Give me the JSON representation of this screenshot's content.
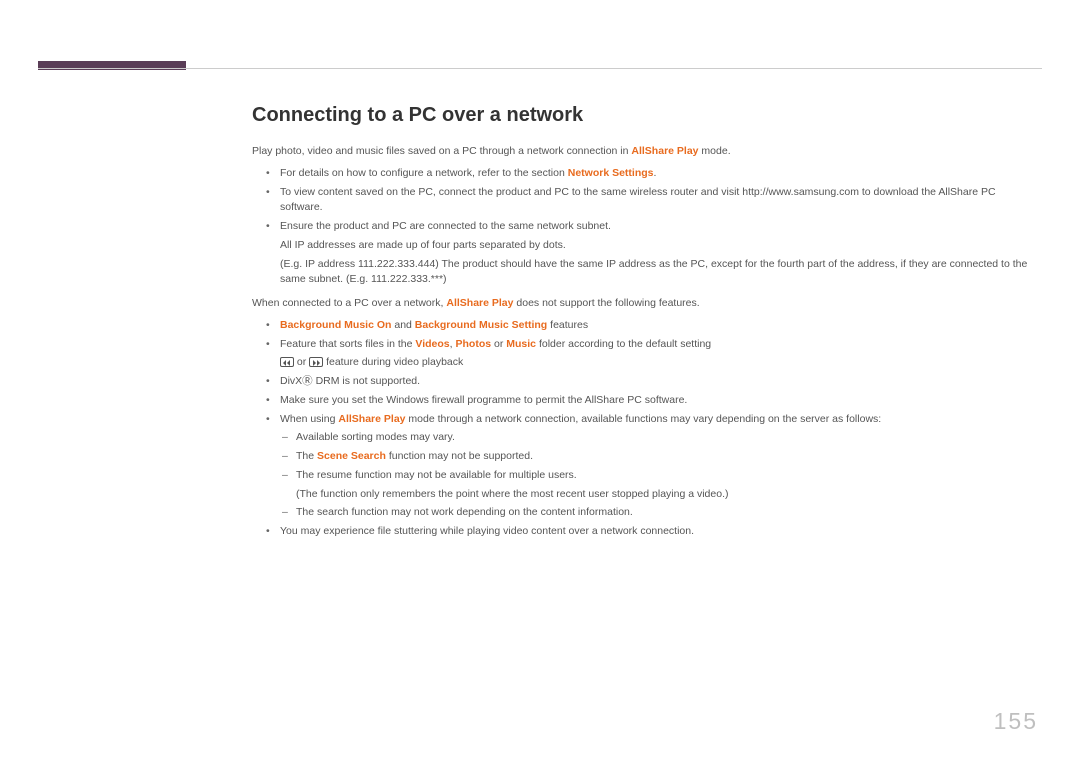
{
  "heading": "Connecting to a PC over a network",
  "intro": {
    "pre": "Play photo, video and music files saved on a PC through a network connection in ",
    "highlight": "AllShare Play",
    "post": " mode."
  },
  "bullets1": {
    "b1": {
      "pre": "For details on how to configure a network, refer to the section ",
      "hl": "Network Settings",
      "post": "."
    },
    "b2": "To view content saved on the PC, connect the product and PC to the same wireless router and visit http://www.samsung.com to download the AllShare PC software.",
    "b3": "Ensure the product and PC are connected to the same network subnet.",
    "b3_sub1": "All IP addresses are made up of four parts separated by dots.",
    "b3_sub2": "(E.g. IP address 111.222.333.444) The product should have the same IP address as the PC, except for the fourth part of the address, if they are connected to the same subnet. (E.g. 111.222.333.***)"
  },
  "mid": {
    "pre": "When connected to a PC over a network, ",
    "hl": "AllShare Play",
    "post": " does not support the following features."
  },
  "bullets2": {
    "b1": {
      "hl1": "Background Music On",
      "mid": " and ",
      "hl2": "Background Music Setting",
      "post": " features"
    },
    "b2": {
      "pre": "Feature that sorts files in the ",
      "hl1": "Videos",
      "sep1": ", ",
      "hl2": "Photos",
      "sep2": " or ",
      "hl3": "Music",
      "post": " folder according to the default setting"
    },
    "b2_sub": {
      "mid": " or ",
      "post": " feature during video playback"
    },
    "b3": "DivXⓇ DRM is not supported.",
    "b4": "Make sure you set the Windows firewall programme to permit the AllShare PC software.",
    "b5": {
      "pre": "When using ",
      "hl": "AllShare Play",
      "post": " mode through a network connection, available functions may vary depending on the server as follows:"
    },
    "b5_d1": "Available sorting modes may vary.",
    "b5_d2": {
      "pre": "The ",
      "hl": "Scene Search",
      "post": " function may not be supported."
    },
    "b5_d3": "The resume function may not be available for multiple users.",
    "b5_d3_sub": "(The function only remembers the point where the most recent user stopped playing a video.)",
    "b5_d4": "The search function may not work depending on the content information.",
    "b6": "You may experience file stuttering while playing video content over a network connection."
  },
  "page_number": "155"
}
